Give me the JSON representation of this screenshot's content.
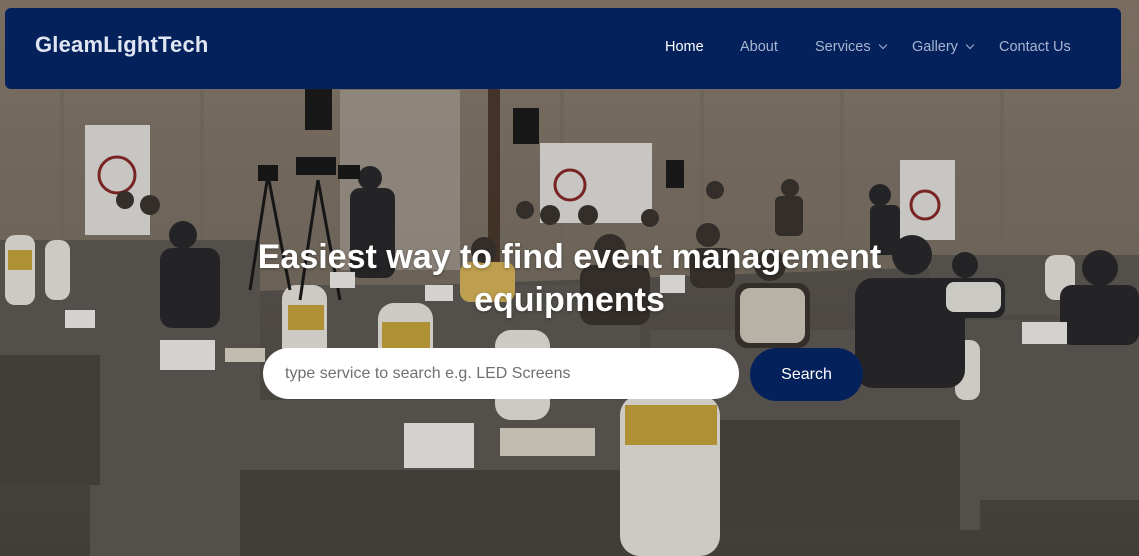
{
  "brand": "GleamLightTech",
  "nav": {
    "items": [
      {
        "label": "Home",
        "active": true
      },
      {
        "label": "About",
        "active": false
      },
      {
        "label": "Services",
        "dropdown": true
      },
      {
        "label": "Gallery",
        "dropdown": true
      },
      {
        "label": "Contact Us",
        "active": false
      }
    ]
  },
  "hero": {
    "headline_line1": "Easiest way to find event management",
    "headline_line2": "equipments",
    "search_placeholder": "type service to search e.g. LED Screens",
    "search_value": "",
    "search_button": "Search"
  },
  "colors": {
    "navbar_bg": "#04215b",
    "button_bg": "#04215b",
    "nav_text": "#a7b6d0",
    "nav_active": "#ffffff"
  }
}
